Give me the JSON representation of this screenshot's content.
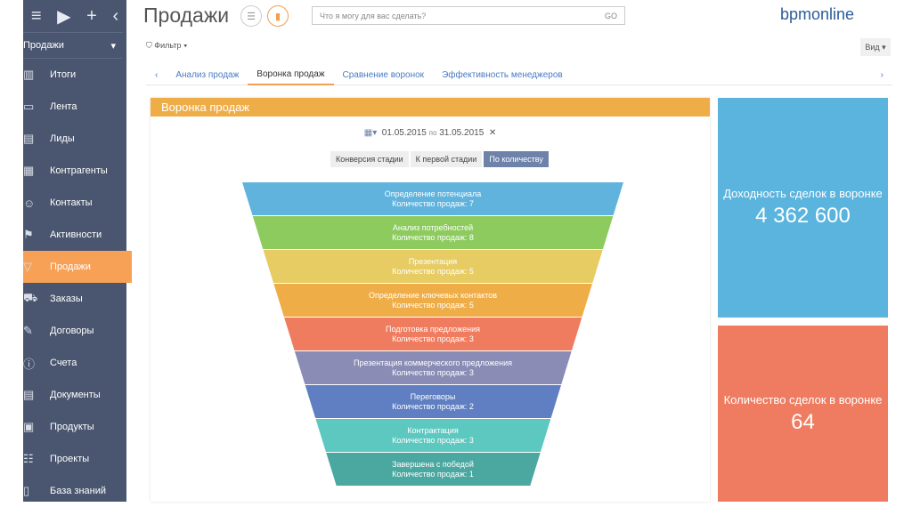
{
  "sidebar": {
    "section": "Продажи",
    "items": [
      {
        "label": "Итоги",
        "icon": "chart-icon"
      },
      {
        "label": "Лента",
        "icon": "feed-icon"
      },
      {
        "label": "Лиды",
        "icon": "leads-icon"
      },
      {
        "label": "Контрагенты",
        "icon": "accounts-icon"
      },
      {
        "label": "Контакты",
        "icon": "contact-icon"
      },
      {
        "label": "Активности",
        "icon": "flag-icon"
      },
      {
        "label": "Продажи",
        "icon": "funnel-icon",
        "active": true
      },
      {
        "label": "Заказы",
        "icon": "cart-icon"
      },
      {
        "label": "Договоры",
        "icon": "contract-icon"
      },
      {
        "label": "Счета",
        "icon": "invoice-icon"
      },
      {
        "label": "Документы",
        "icon": "document-icon"
      },
      {
        "label": "Продукты",
        "icon": "product-icon"
      },
      {
        "label": "Проекты",
        "icon": "project-icon"
      },
      {
        "label": "База знаний",
        "icon": "book-icon"
      }
    ]
  },
  "header": {
    "title": "Продажи",
    "search_placeholder": "Что я могу для вас сделать?",
    "go": "GO",
    "logo": "bpmonline",
    "filter": "Фильтр",
    "view": "Вид"
  },
  "tabs": [
    "Анализ продаж",
    "Воронка продаж",
    "Сравнение воронок",
    "Эффективность менеджеров"
  ],
  "panel": {
    "title": "Воронка продаж",
    "date_from": "01.05.2015",
    "date_sep": "по",
    "date_to": "31.05.2015",
    "modes": [
      "Конверсия стадии",
      "К первой стадии",
      "По количеству"
    ]
  },
  "chart_data": {
    "type": "funnel",
    "stages": [
      {
        "name": "Определение потенциала",
        "label": "Количество продаж: 7",
        "value": 7,
        "color": "#5fb3dd"
      },
      {
        "name": "Анализ потребностей",
        "label": "Количество продаж: 8",
        "value": 8,
        "color": "#8dcb5e"
      },
      {
        "name": "Презентация",
        "label": "Количество продаж: 5",
        "value": 5,
        "color": "#e6cc63"
      },
      {
        "name": "Определение ключевых контактов",
        "label": "Количество продаж: 5",
        "value": 5,
        "color": "#efad48"
      },
      {
        "name": "Подготовка предложения",
        "label": "Количество продаж: 3",
        "value": 3,
        "color": "#ef7c5e"
      },
      {
        "name": "Презентация коммерческого предложения",
        "label": "Количество продаж: 3",
        "value": 3,
        "color": "#8b8cb5"
      },
      {
        "name": "Переговоры",
        "label": "Количество продаж: 2",
        "value": 2,
        "color": "#5f7fc2"
      },
      {
        "name": "Контрактация",
        "label": "Количество продаж: 3",
        "value": 3,
        "color": "#5cc8c0"
      },
      {
        "name": "Завершена с победой",
        "label": "Количество продаж: 1",
        "value": 1,
        "color": "#4aa8a0"
      }
    ]
  },
  "cards": [
    {
      "title": "Доходность сделок в воронке",
      "value": "4 362 600",
      "color": "#5ab4de"
    },
    {
      "title": "Количество сделок в воронке",
      "value": "64",
      "color": "#ef7c61"
    }
  ]
}
